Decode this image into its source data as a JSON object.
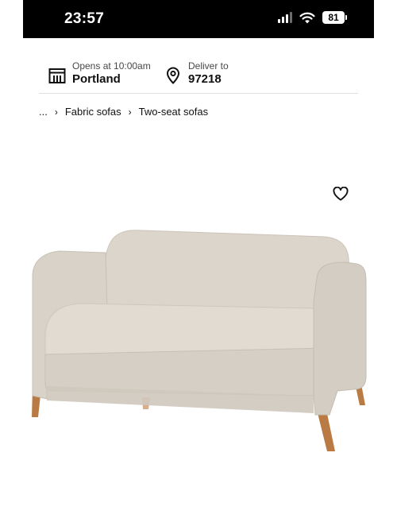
{
  "status_bar": {
    "time": "23:57",
    "battery": "81"
  },
  "store": {
    "hours_label": "Opens at 10:00am",
    "store_name": "Portland",
    "deliver_label": "Deliver to",
    "zip": "97218"
  },
  "breadcrumb": {
    "ellipsis": "...",
    "items": [
      "Fabric sofas",
      "Two-seat sofas"
    ]
  },
  "icons": {
    "store": "store-icon",
    "location": "location-pin-icon",
    "favorite": "heart-outline-icon",
    "chevron": "chevron-right-icon"
  },
  "colors": {
    "status_bar_bg": "#000000",
    "sofa_fabric": "#d6cfc5",
    "sofa_legs": "#b97b43"
  }
}
